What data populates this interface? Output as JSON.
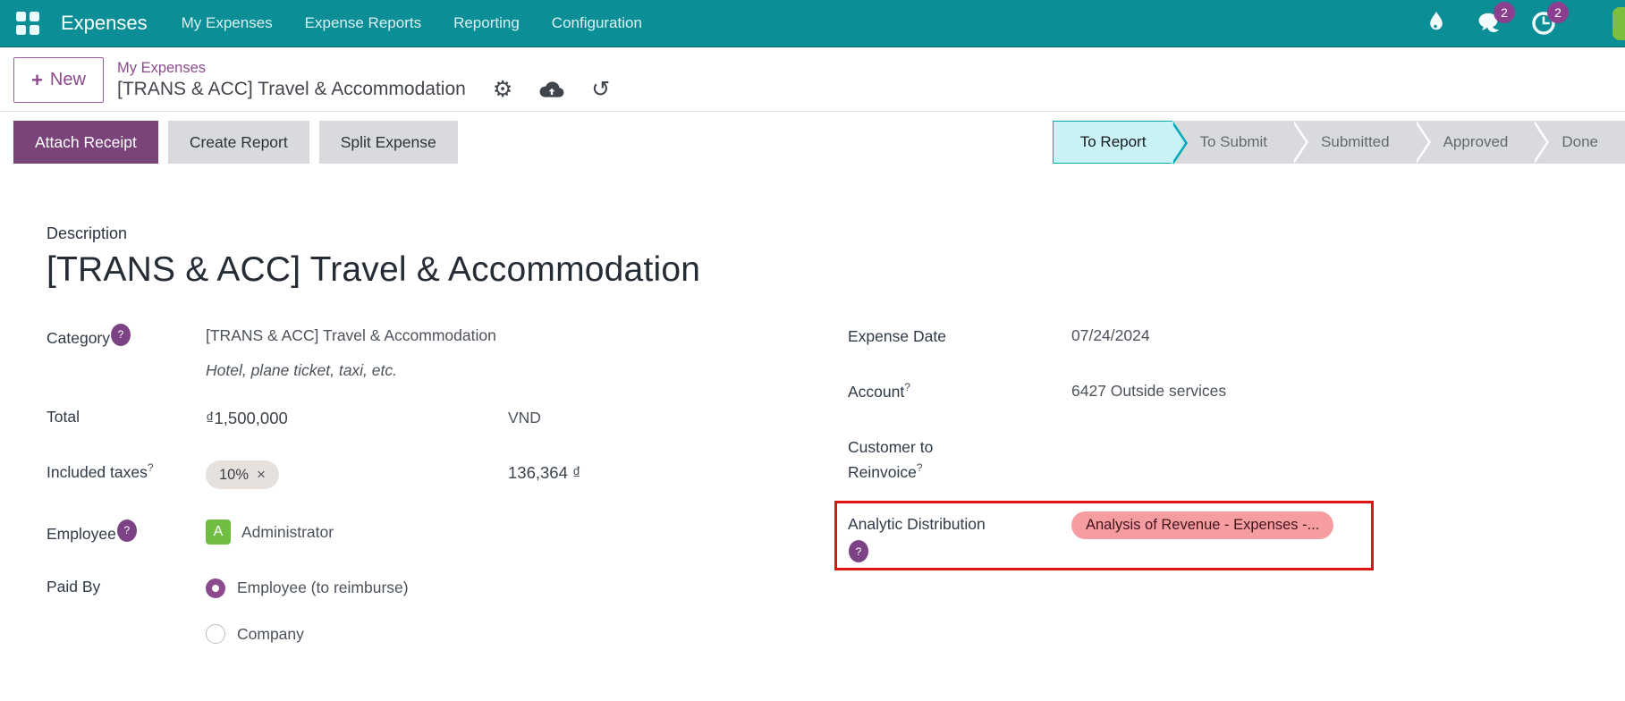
{
  "nav": {
    "app": "Expenses",
    "menu": [
      "My Expenses",
      "Expense Reports",
      "Reporting",
      "Configuration"
    ],
    "messages_badge": "2",
    "activities_badge": "2"
  },
  "breadcrumb": {
    "plus": "+",
    "new_label": "New",
    "parent": "My Expenses",
    "current": "[TRANS & ACC] Travel & Accommodation"
  },
  "icons": {
    "gear": "⚙",
    "refresh": "↺"
  },
  "actions": {
    "attach_receipt": "Attach Receipt",
    "create_report": "Create Report",
    "split_expense": "Split Expense"
  },
  "statusbar": {
    "to_report": "To Report",
    "to_submit": "To Submit",
    "submitted": "Submitted",
    "approved": "Approved",
    "done": "Done",
    "active": "To Report"
  },
  "form": {
    "help_mark": "?",
    "description_label": "Description",
    "title": "[TRANS & ACC] Travel & Accommodation",
    "category": {
      "label": "Category",
      "value": "[TRANS & ACC] Travel & Accommodation",
      "hint": "Hotel, plane ticket, taxi, etc."
    },
    "total": {
      "label": "Total",
      "value": "₫1,500,000",
      "currency": "VND"
    },
    "included_taxes": {
      "label": "Included taxes",
      "tag": "10%",
      "remove": "×",
      "amount": "136,364 ₫"
    },
    "employee": {
      "label": "Employee",
      "avatar_initial": "A",
      "value": "Administrator"
    },
    "paid_by": {
      "label": "Paid By",
      "option_selected": "Employee (to reimburse)",
      "option_other": "Company"
    },
    "expense_date": {
      "label": "Expense Date",
      "value": "07/24/2024"
    },
    "account": {
      "label": "Account",
      "value": "6427 Outside services"
    },
    "customer_to_reinvoice": {
      "label": "Customer to Reinvoice",
      "value": ""
    },
    "analytic_distribution": {
      "label": "Analytic Distribution",
      "tag": "Analysis of Revenue - Expenses -..."
    }
  },
  "colors": {
    "navbar_teal": "#0b8e95",
    "accent_purple": "#8b4a8b",
    "primary_button_purple": "#7a447a",
    "nav_badge_purple": "#8a3f8f",
    "help_badge_purple": "#7d4185",
    "stage_active_bg": "#c9f2f6",
    "stage_active_border": "#00a9b5",
    "tag_pink": "#f59da1",
    "annotation_red": "#e01313",
    "avatar_green": "#71bd44"
  }
}
